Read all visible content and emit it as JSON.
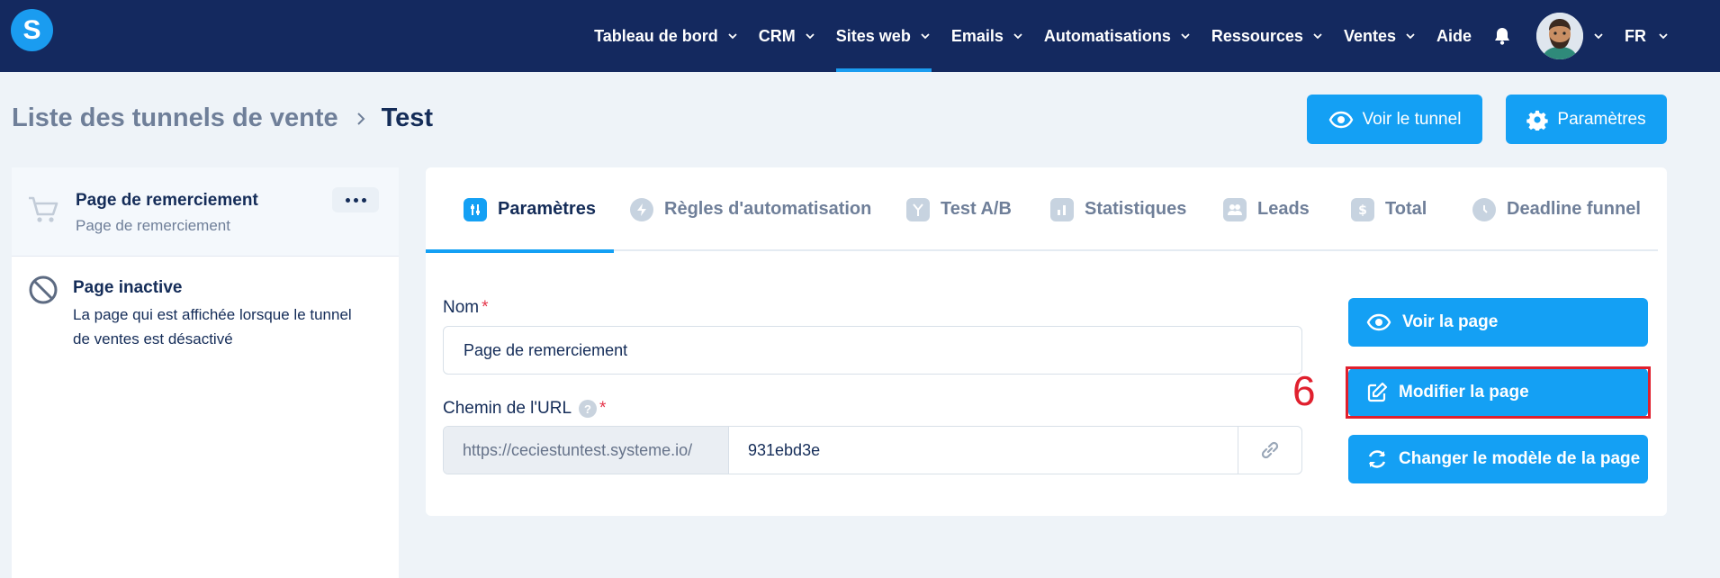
{
  "nav": {
    "logo_letter": "S",
    "items": [
      {
        "label": "Tableau de bord",
        "has_dropdown": true,
        "active": false
      },
      {
        "label": "CRM",
        "has_dropdown": true,
        "active": false
      },
      {
        "label": "Sites web",
        "has_dropdown": true,
        "active": true
      },
      {
        "label": "Emails",
        "has_dropdown": true,
        "active": false
      },
      {
        "label": "Automatisations",
        "has_dropdown": true,
        "active": false
      },
      {
        "label": "Ressources",
        "has_dropdown": true,
        "active": false
      },
      {
        "label": "Ventes",
        "has_dropdown": true,
        "active": false
      },
      {
        "label": "Aide",
        "has_dropdown": false,
        "active": false
      }
    ],
    "language": "FR",
    "icons": [
      "bell-icon",
      "avatar",
      "chevron-down-icon"
    ]
  },
  "header": {
    "breadcrumb_parent": "Liste des tunnels de vente",
    "breadcrumb_current": "Test",
    "view_funnel_label": "Voir le tunnel",
    "settings_label": "Paramètres"
  },
  "sidebar": {
    "active_item": {
      "title": "Page de remerciement",
      "subtitle": "Page de remerciement"
    },
    "inactive_item": {
      "title": "Page inactive",
      "description": "La page qui est affichée lorsque le tunnel de ventes est désactivé"
    }
  },
  "tabs": [
    {
      "label": "Paramètres",
      "icon": "sliders-icon",
      "active": true
    },
    {
      "label": "Règles d'automatisation",
      "icon": "bolt-icon",
      "active": false
    },
    {
      "label": "Test A/B",
      "icon": "split-icon",
      "active": false
    },
    {
      "label": "Statistiques",
      "icon": "bar-chart-icon",
      "active": false
    },
    {
      "label": "Leads",
      "icon": "users-icon",
      "active": false
    },
    {
      "label": "Total",
      "icon": "dollar-icon",
      "active": false
    },
    {
      "label": "Deadline funnel",
      "icon": "clock-icon",
      "active": false
    }
  ],
  "form": {
    "name_label": "Nom",
    "name_value": "Page de remerciement",
    "url_label": "Chemin de l'URL",
    "url_prefix": "https://ceciestuntest.systeme.io/",
    "url_path": "931ebd3e",
    "required_mark": "*",
    "help_mark": "?"
  },
  "actions": {
    "view_page": "Voir la page",
    "edit_page": "Modifier la page",
    "change_template": "Changer le modèle de la page"
  },
  "annotation": {
    "step_number": "6",
    "color": "#e0202e"
  },
  "colors": {
    "nav_bg": "#14295f",
    "accent": "#14a0f4",
    "page_bg": "#eef3f8"
  }
}
